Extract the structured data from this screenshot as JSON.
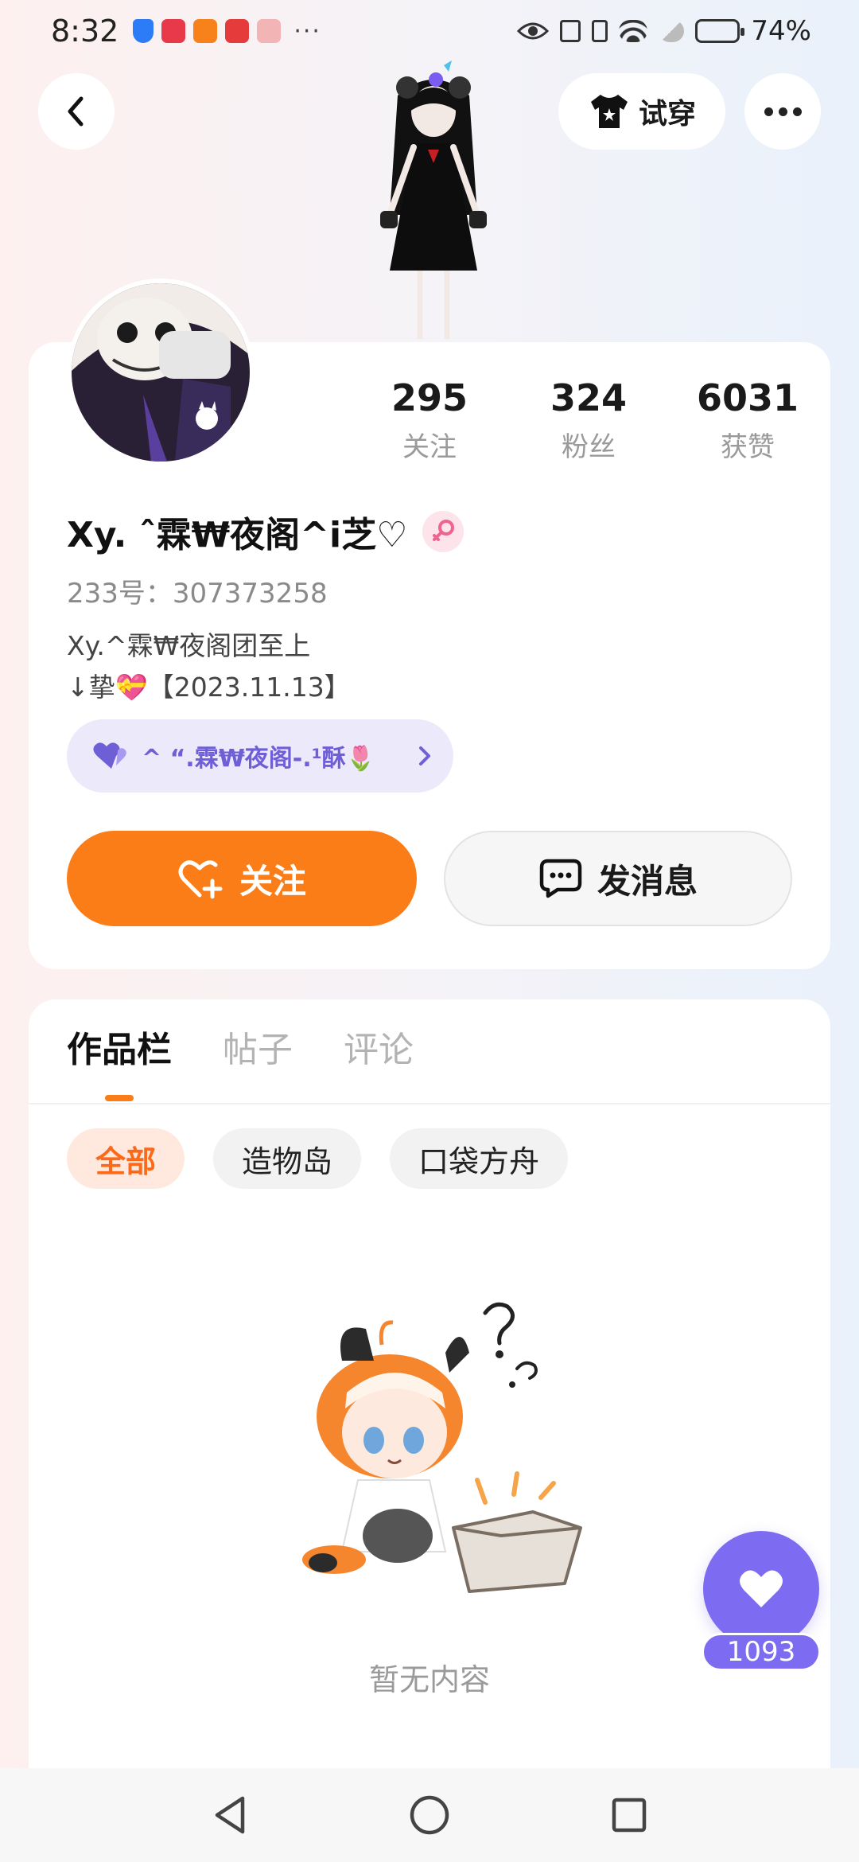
{
  "status_bar": {
    "time": "8:32",
    "notif_more": "···",
    "battery_percent": "74%",
    "battery_level": 0.74
  },
  "header": {
    "tryon_label": "试穿"
  },
  "profile": {
    "stats": [
      {
        "num": "295",
        "label": "关注"
      },
      {
        "num": "324",
        "label": "粉丝"
      },
      {
        "num": "6031",
        "label": "获赞"
      }
    ],
    "nickname": "Xy. ˆ霖₩夜阁^i芝♡",
    "uid": "233号：307373258",
    "bio_line1": "Xy.^霖₩夜阁团至上",
    "bio_line2": "↓挚💝【2023.11.13】",
    "group_name": "^ “.霖₩夜阁-.¹酥🌷",
    "follow_label": "关注",
    "message_label": "发消息"
  },
  "content": {
    "tabs": [
      {
        "label": "作品栏"
      },
      {
        "label": "帖子"
      },
      {
        "label": "评论"
      }
    ],
    "filters": [
      {
        "label": "全部"
      },
      {
        "label": "造物岛"
      },
      {
        "label": "口袋方舟"
      }
    ],
    "empty_text": "暂无内容"
  },
  "fab": {
    "like_count": "1093"
  },
  "colors": {
    "accent_orange": "#fb7d17",
    "accent_purple": "#7d6cf1"
  }
}
